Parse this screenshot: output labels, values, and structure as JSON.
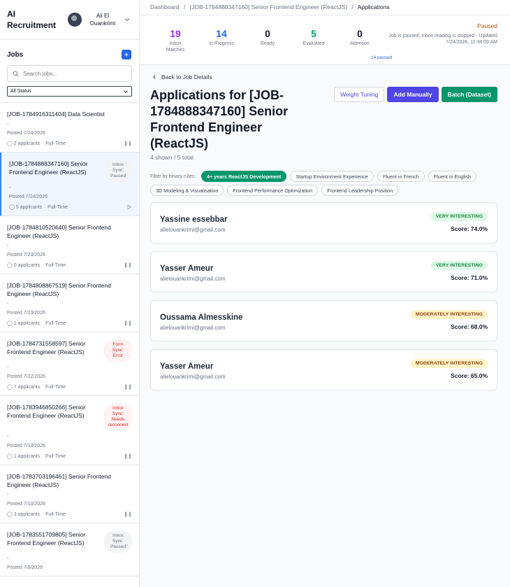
{
  "sidebar": {
    "brand": "AI Recruitment",
    "user_name": "Ali El Ouankrimi",
    "jobs_title": "Jobs",
    "add_label": "+",
    "search_placeholder": "Search jobs...",
    "status_filter": "All Status",
    "jobs": [
      {
        "title": "[JOB-1784916311404] Data Scientist",
        "posted": "Posted 7/24/2026",
        "applicants": "2 applicants",
        "type": "Full-Time",
        "sync": "",
        "ctl": "pause"
      },
      {
        "title": "[JOB-1784888347160] Senior Frontend Engineer (ReactJS)",
        "posted": "Posted 7/24/2026",
        "applicants": "5 applicants",
        "type": "Full-Time",
        "sync": "Inbox Sync: Paused",
        "ctl": "play",
        "active": true
      },
      {
        "title": "[JOB-1784810520640] Senior Frontend Engineer (ReactJS)",
        "posted": "Posted 7/23/2026",
        "applicants": "0 applicants",
        "type": "Full-Time",
        "sync": "",
        "ctl": "pause"
      },
      {
        "title": "[JOB-1784808867519] Senior Frontend Engineer (ReactJS)",
        "posted": "Posted 7/23/2026",
        "applicants": "1 applicants",
        "type": "Full-Time",
        "sync": "",
        "ctl": "pause"
      },
      {
        "title": "[JOB-1784731558597] Senior Frontend Engineer (ReactJS)",
        "posted": "Posted 7/22/2026",
        "applicants": "7 applicants",
        "type": "Full-Time",
        "sync": "Form Sync: Error",
        "sync_kind": "red",
        "ctl": "pause"
      },
      {
        "title": "[JOB-1783946850266] Senior Frontend Engineer (ReactJS)",
        "posted": "Posted 7/13/2026",
        "applicants": "1 applicants",
        "type": "Full-Time",
        "sync": "Inbox Sync: Needs reconnect",
        "sync_kind": "red",
        "ctl": "pause"
      },
      {
        "title": "[JOB-1783703196461] Senior Frontend Engineer (ReactJS)",
        "posted": "Posted 7/10/2026",
        "applicants": "3 applicants",
        "type": "Full-Time",
        "sync": "",
        "ctl": "pause"
      },
      {
        "title": "[JOB-1783551709805] Senior Frontend Engineer (ReactJS)",
        "posted": "Posted 7/9/2026",
        "applicants": "",
        "type": "",
        "sync": "Inbox Sync: Paused",
        "ctl": ""
      }
    ]
  },
  "breadcrumb": {
    "dashboard": "Dashboard",
    "job": "[JOB-1784888347160] Senior Frontend Engineer (ReactJS)",
    "current": "Applications",
    "sep": "/"
  },
  "stats": {
    "inbox_matches": {
      "value": "19",
      "label": "Inbox Matches",
      "color": "#9333ea"
    },
    "in_progress": {
      "value": "14",
      "label": "In Progress",
      "color": "#2563eb"
    },
    "ready": {
      "value": "0",
      "label": "Ready",
      "color": "#111827"
    },
    "evaluated": {
      "value": "5",
      "label": "Evaluated",
      "color": "#059669"
    },
    "attention": {
      "value": "0",
      "label": "Attention",
      "color": "#111827"
    },
    "status": "Paused",
    "status_message": "Job is paused; inbox reading is stopped - Updated 7/24/2026, 11:38:09 AM",
    "paused_count": "14 paused"
  },
  "page": {
    "back_label": "Back to Job Details",
    "title": "Applications for [JOB-1784888347160] Senior Frontend Engineer (ReactJS)",
    "shown": "4 shown / 5 total",
    "buttons": {
      "weight": "Weight Tuning",
      "add": "Add Manually",
      "batch": "Batch (Dataset)"
    },
    "filter_label": "Filter by binary rules:",
    "filters": [
      {
        "label": "4+ years ReactJS Development",
        "active": true
      },
      {
        "label": "Startup Environment Experience",
        "active": false
      },
      {
        "label": "Fluent in French",
        "active": false
      },
      {
        "label": "Fluent in English",
        "active": false
      },
      {
        "label": "3D Modeling & Visualisation",
        "active": false
      },
      {
        "label": "Frontend Performance Optimization",
        "active": false
      },
      {
        "label": "Frontend Leadership Position",
        "active": false
      }
    ]
  },
  "candidates": [
    {
      "name": "Yassine essebbar",
      "email": "alielouankrimi@gmail.com",
      "badge": "VERY INTERESTING",
      "badge_kind": "green",
      "score": "Score: 74.0%"
    },
    {
      "name": "Yasser Ameur",
      "email": "alielouankrimi@gmail.com",
      "badge": "VERY INTERESTING",
      "badge_kind": "green",
      "score": "Score: 71.0%"
    },
    {
      "name": "Oussama Almesskine",
      "email": "alielouankrimi@gmail.com",
      "badge": "MODERATELY INTERESTING",
      "badge_kind": "yellow",
      "score": "Score: 68.0%"
    },
    {
      "name": "Yasser Ameur",
      "email": "alielouankrimi@gmail.com",
      "badge": "MODERATELY INTERESTING",
      "badge_kind": "yellow",
      "score": "Score: 65.0%"
    }
  ]
}
